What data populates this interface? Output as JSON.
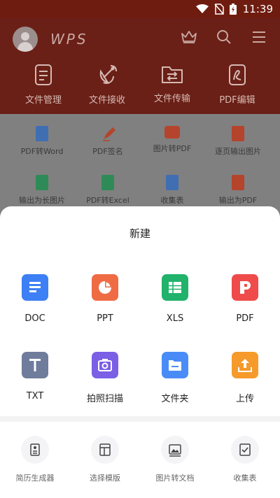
{
  "status_bar": {
    "time": "11:39"
  },
  "header": {
    "logo": "WPS",
    "quick_actions": [
      {
        "label": "文件管理",
        "icon": "document-icon"
      },
      {
        "label": "文件接收",
        "icon": "satellite-dish-icon"
      },
      {
        "label": "文件传输",
        "icon": "folder-transfer-icon"
      },
      {
        "label": "PDF编辑",
        "icon": "pdf-edit-icon"
      }
    ]
  },
  "features": [
    {
      "label": "PDF转Word",
      "color": "#3f6eb3"
    },
    {
      "label": "PDF签名",
      "color": "#b5442c"
    },
    {
      "label": "图片转PDF",
      "color": "#b5442c"
    },
    {
      "label": "逐页输出图片",
      "color": "#b5442c"
    },
    {
      "label": "输出为长图片",
      "color": "#2e8b57"
    },
    {
      "label": "PDF转Excel",
      "color": "#2e8b57"
    },
    {
      "label": "收集表",
      "color": "#3f6eb3"
    },
    {
      "label": "输出为PDF",
      "color": "#b5442c"
    }
  ],
  "new_sheet": {
    "title": "新建",
    "items": [
      {
        "label": "DOC",
        "icon": "doc-icon",
        "color": "#3d7ff5"
      },
      {
        "label": "PPT",
        "icon": "ppt-icon",
        "color": "#ef6b44"
      },
      {
        "label": "XLS",
        "icon": "xls-icon",
        "color": "#21b26b"
      },
      {
        "label": "PDF",
        "icon": "pdf-icon",
        "color": "#ef4b4b"
      },
      {
        "label": "TXT",
        "icon": "txt-icon",
        "color": "#6f7c9c"
      },
      {
        "label": "拍照扫描",
        "icon": "camera-scan-icon",
        "color": "#7b5fe5"
      },
      {
        "label": "文件夹",
        "icon": "folder-icon",
        "color": "#4a8cf7"
      },
      {
        "label": "上传",
        "icon": "upload-icon",
        "color": "#f59a2b"
      }
    ],
    "tools": [
      {
        "label": "简历生成器",
        "icon": "resume-icon"
      },
      {
        "label": "选择模版",
        "icon": "template-icon"
      },
      {
        "label": "图片转文档",
        "icon": "image-to-doc-icon"
      },
      {
        "label": "收集表",
        "icon": "form-collect-icon"
      }
    ]
  }
}
